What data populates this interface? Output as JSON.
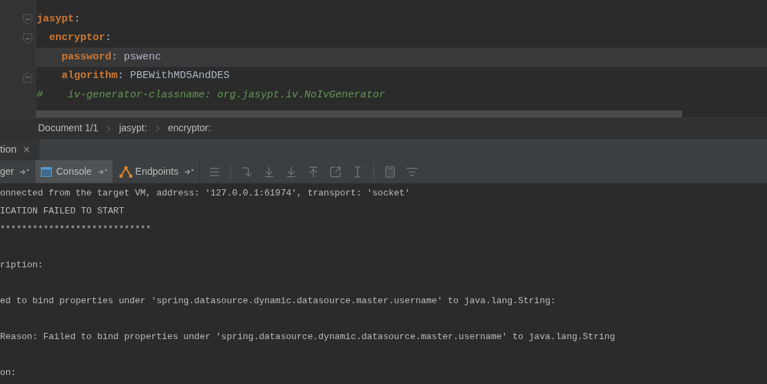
{
  "editor": {
    "yaml": [
      {
        "key": "jasypt",
        "colon": ":",
        "children": [
          {
            "key": "encryptor",
            "colon": ":",
            "children": [
              {
                "key": "password",
                "colon": ":",
                "value": "pswenc",
                "current": true
              },
              {
                "key": "algorithm",
                "colon": ":",
                "value": "PBEWithMD5AndDES",
                "current": false
              }
            ]
          }
        ]
      }
    ],
    "comment": "#    iv-generator-classname: org.jasypt.iv.NoIvGenerator"
  },
  "breadcrumbs": [
    "Document 1/1",
    "jasypt:",
    "encryptor:"
  ],
  "tool_window": {
    "tab": {
      "label": "tion"
    },
    "tabs": [
      {
        "label": "ger",
        "selected": false,
        "kind": "plain"
      },
      {
        "label": "Console",
        "selected": true,
        "kind": "console"
      },
      {
        "label": "Endpoints",
        "selected": false,
        "kind": "endpoints"
      }
    ],
    "console_lines": [
      {
        "kind": "text",
        "text": "onnected from the target VM, address: '127.0.0.1:61974', transport: 'socket'"
      },
      {
        "kind": "text",
        "text": "ICATION FAILED TO START"
      },
      {
        "kind": "text",
        "text": "****************************"
      },
      {
        "kind": "blank"
      },
      {
        "kind": "text",
        "text": "ription:"
      },
      {
        "kind": "blank"
      },
      {
        "kind": "text",
        "text": "ed to bind properties under 'spring.datasource.dynamic.datasource.master.username' to java.lang.String:"
      },
      {
        "kind": "blank"
      },
      {
        "kind": "text",
        "text": "Reason: Failed to bind properties under 'spring.datasource.dynamic.datasource.master.username' to java.lang.String"
      },
      {
        "kind": "blank"
      },
      {
        "kind": "text",
        "text": "on:"
      }
    ]
  }
}
